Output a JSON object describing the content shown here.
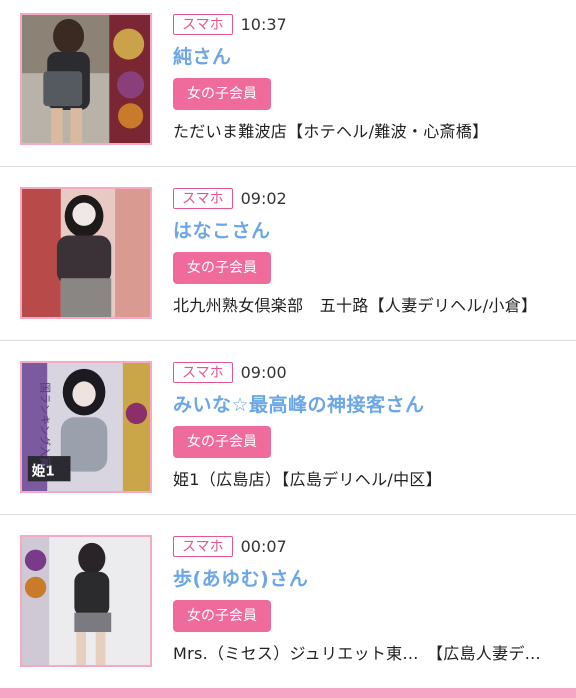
{
  "posts": [
    {
      "device": "スマホ",
      "time": "10:37",
      "name": "純さん",
      "member_label": "女の子会員",
      "shop": "ただいま難波店【ホテヘル/難波・心斎橋】"
    },
    {
      "device": "スマホ",
      "time": "09:02",
      "name": "はなこさん",
      "member_label": "女の子会員",
      "shop": "北九州熟女倶楽部　五十路【人妻デリヘル/小倉】"
    },
    {
      "device": "スマホ",
      "time": "09:00",
      "name": "みいな☆最高峰の神接客さん",
      "member_label": "女の子会員",
      "shop": "姫1（広島店）【広島デリヘル/中区】"
    },
    {
      "device": "スマホ",
      "time": "00:07",
      "name": "歩(あゆむ)さん",
      "member_label": "女の子会員",
      "shop": "Mrs.（ミセス）ジュリエット東...　【広島人妻デ..."
    }
  ],
  "thumbnail_overlays": {
    "post3": [
      "姫1",
      "国ランキング入賞"
    ]
  },
  "colors": {
    "accent_pink": "#ef6b9b",
    "name_blue": "#6aa6e8",
    "thumb_border": "#f6a9c5",
    "bottom_bar": "#f5a6c4"
  }
}
